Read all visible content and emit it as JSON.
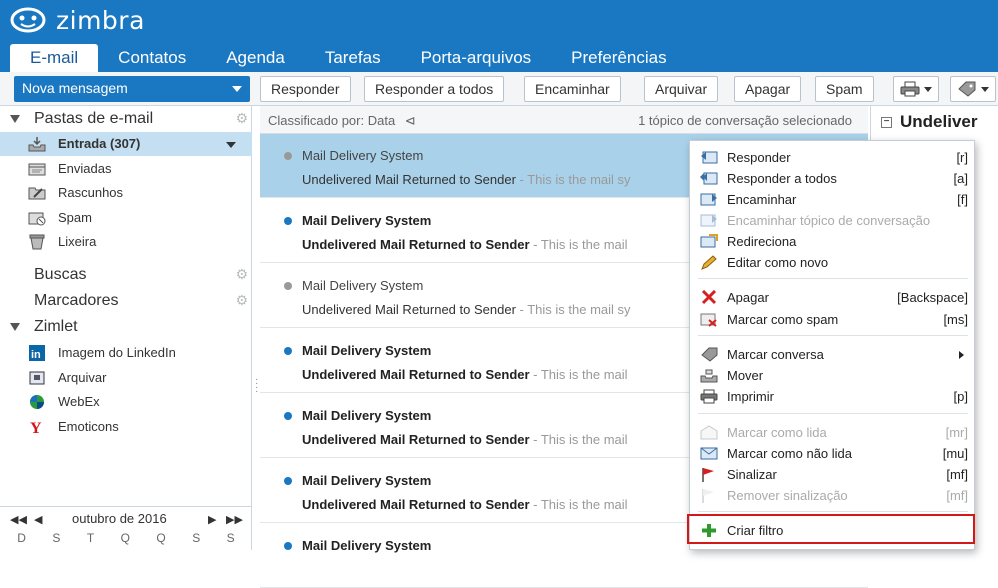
{
  "app": {
    "brand": "zimbra"
  },
  "tabs": [
    {
      "label": "E-mail",
      "active": true
    },
    {
      "label": "Contatos"
    },
    {
      "label": "Agenda"
    },
    {
      "label": "Tarefas"
    },
    {
      "label": "Porta-arquivos"
    },
    {
      "label": "Preferências"
    }
  ],
  "toolbar": {
    "new_message": "Nova mensagem",
    "reply": "Responder",
    "reply_all": "Responder a todos",
    "forward": "Encaminhar",
    "archive": "Arquivar",
    "delete": "Apagar",
    "spam": "Spam"
  },
  "sidebar": {
    "mail_folders_title": "Pastas de e-mail",
    "folders": [
      {
        "label": "Entrada (307)",
        "icon": "inbox-icon"
      },
      {
        "label": "Enviadas",
        "icon": "sent-icon"
      },
      {
        "label": "Rascunhos",
        "icon": "drafts-icon"
      },
      {
        "label": "Spam",
        "icon": "spam-icon"
      },
      {
        "label": "Lixeira",
        "icon": "trash-icon"
      }
    ],
    "searches": "Buscas",
    "tags": "Marcadores",
    "zimlet_title": "Zimlet",
    "zimlets": [
      {
        "label": "Imagem do LinkedIn",
        "icon": "linkedin-icon"
      },
      {
        "label": "Arquivar",
        "icon": "archive-icon"
      },
      {
        "label": "WebEx",
        "icon": "webex-icon"
      },
      {
        "label": "Emoticons",
        "icon": "yahoo-icon"
      }
    ],
    "calendar": {
      "month": "outubro de 2016",
      "days": [
        "D",
        "S",
        "T",
        "Q",
        "Q",
        "S",
        "S"
      ]
    }
  },
  "list": {
    "sort_label": "Classificado por: Data",
    "selection": "1 tópico de conversação selecionado",
    "messages": [
      {
        "from": "Mail Delivery System",
        "subject": "Undelivered Mail Returned to Sender",
        "snippet": " - This is the mail sy",
        "unread": false,
        "selected": true
      },
      {
        "from": "Mail Delivery System",
        "subject": "Undelivered Mail Returned to Sender",
        "snippet": " - This is the mail",
        "unread": true
      },
      {
        "from": "Mail Delivery System",
        "subject": "Undelivered Mail Returned to Sender",
        "snippet": " - This is the mail sy",
        "unread": false
      },
      {
        "from": "Mail Delivery System",
        "subject": "Undelivered Mail Returned to Sender",
        "snippet": " - This is the mail",
        "unread": true
      },
      {
        "from": "Mail Delivery System",
        "subject": "Undelivered Mail Returned to Sender",
        "snippet": " - This is the mail",
        "unread": true
      },
      {
        "from": "Mail Delivery System",
        "subject": "Undelivered Mail Returned to Sender",
        "snippet": " - This is the mail",
        "unread": true
      },
      {
        "from": "Mail Delivery System",
        "subject": "",
        "snippet": "",
        "unread": true
      }
    ]
  },
  "reader": {
    "title": "Undeliver"
  },
  "context_menu": {
    "items": [
      {
        "label": "Responder",
        "key": "[r]",
        "icon": "reply-icon"
      },
      {
        "label": "Responder a todos",
        "key": "[a]",
        "icon": "reply-all-icon"
      },
      {
        "label": "Encaminhar",
        "key": "[f]",
        "icon": "forward-icon"
      },
      {
        "label": "Encaminhar tópico de conversação",
        "key": "",
        "icon": "forward-thread-icon",
        "disabled": true
      },
      {
        "label": "Redireciona",
        "key": "",
        "icon": "redirect-icon"
      },
      {
        "label": "Editar como novo",
        "key": "",
        "icon": "pencil-icon"
      },
      {
        "label": "Apagar",
        "key": "[Backspace]",
        "icon": "delete-x-icon"
      },
      {
        "label": "Marcar como spam",
        "key": "[ms]",
        "icon": "spam-mark-icon"
      },
      {
        "label": "Marcar conversa",
        "key": "",
        "icon": "tag-icon"
      },
      {
        "label": "Mover",
        "key": "",
        "icon": "move-icon"
      },
      {
        "label": "Imprimir",
        "key": "[p]",
        "icon": "printer-icon"
      },
      {
        "label": "Marcar como lida",
        "key": "[mr]",
        "icon": "read-icon",
        "disabled": true
      },
      {
        "label": "Marcar como não lida",
        "key": "[mu]",
        "icon": "unread-icon"
      },
      {
        "label": "Sinalizar",
        "key": "[mf]",
        "icon": "flag-icon"
      },
      {
        "label": "Remover sinalização",
        "key": "[mf]",
        "icon": "unflag-icon",
        "disabled": true
      },
      {
        "label": "Criar filtro",
        "key": "",
        "icon": "plus-icon"
      }
    ]
  },
  "colors": {
    "brand": "#1a78c2",
    "selected_row": "#a9d2ea",
    "highlight": "#d41717"
  }
}
